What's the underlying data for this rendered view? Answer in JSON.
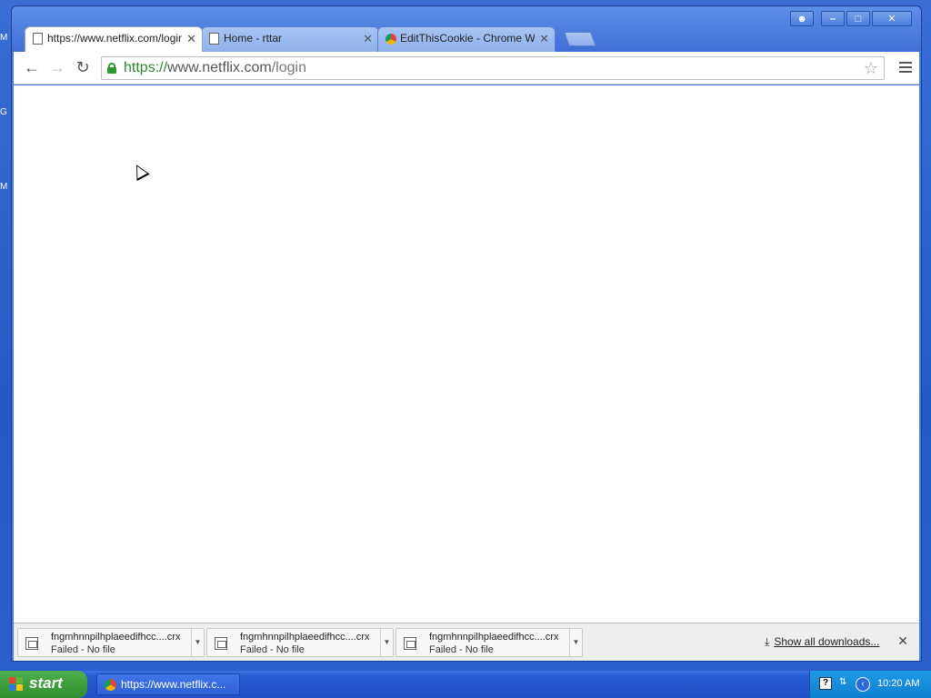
{
  "desktop": {
    "icons": [
      {
        "label": "M"
      },
      {
        "label": "G"
      },
      {
        "label": "M"
      }
    ]
  },
  "window": {
    "controls": {
      "user": "user-icon",
      "minimize": "–",
      "maximize": "□",
      "close": "✕"
    }
  },
  "tabs": [
    {
      "title": "https://www.netflix.com/login",
      "icon": "page-icon",
      "active": true,
      "close": "✕"
    },
    {
      "title": "Home - rttar",
      "icon": "page-icon",
      "active": false,
      "close": "✕"
    },
    {
      "title": "EditThisCookie - Chrome Web Store",
      "icon": "chrome-icon",
      "active": false,
      "close": "✕"
    }
  ],
  "toolbar": {
    "back": "←",
    "forward": "→",
    "reload": "↻",
    "url": {
      "scheme": "https://",
      "host": "www.netflix.com",
      "path": "/login"
    },
    "bookmark": "☆"
  },
  "downloads": {
    "items": [
      {
        "name": "fngmhnnpilhplaeedifhcc....crx",
        "status": "Failed - No file"
      },
      {
        "name": "fngmhnnpilhplaeedifhcc....crx",
        "status": "Failed - No file"
      },
      {
        "name": "fngmhnnpilhplaeedifhcc....crx",
        "status": "Failed - No file"
      }
    ],
    "show_all": "Show all downloads...",
    "close": "✕",
    "arrow": "▼"
  },
  "taskbar": {
    "start_label": "start",
    "task_title": "https://www.netflix.c...",
    "help": "?",
    "clock": "10:20 AM"
  },
  "colors": {
    "accent_green": "#2e8a2e",
    "taskbar_blue": "#245ad0",
    "start_green": "#3a9e3a"
  }
}
